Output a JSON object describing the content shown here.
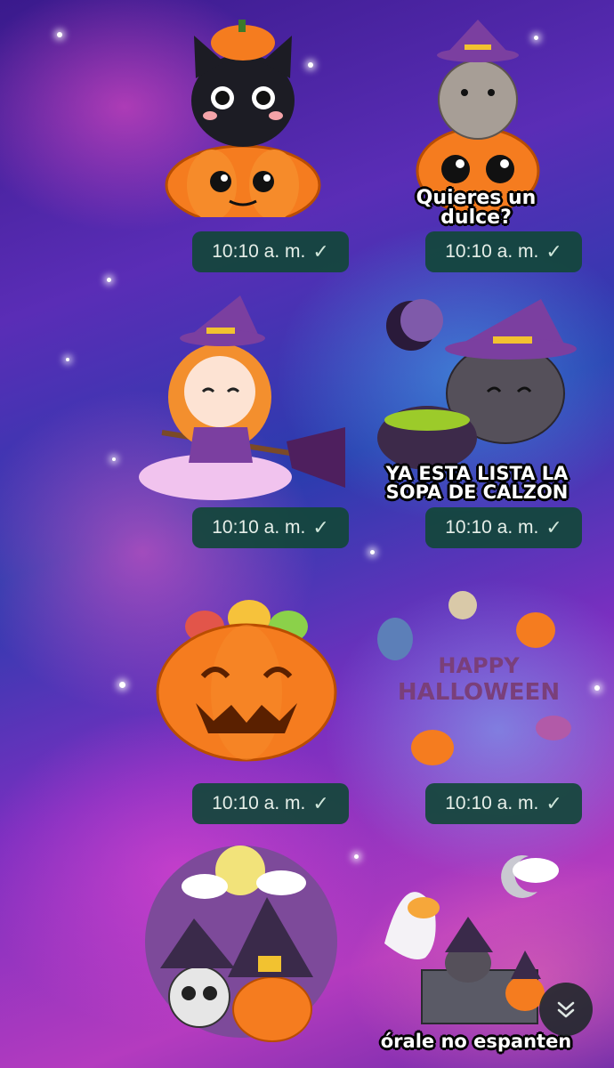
{
  "messages": [
    {
      "time": "10:10 a. m.",
      "caption": ""
    },
    {
      "time": "10:10 a. m.",
      "caption": "Quieres un dulce?"
    },
    {
      "time": "10:10 a. m.",
      "caption": ""
    },
    {
      "time": "10:10 a. m.",
      "caption": "YA ESTA LISTA LA SOPA DE CALZON"
    },
    {
      "time": "10:10 a. m.",
      "caption": ""
    },
    {
      "time": "10:10 a. m.",
      "caption": ""
    },
    {
      "time": "",
      "caption": ""
    },
    {
      "time": "",
      "caption": "órale no espanten"
    }
  ],
  "stickers": {
    "halloween_text": "HAPPY HALLOWEEN"
  },
  "icons": {
    "read_receipt": "check-icon",
    "scroll_down": "double-chevron-down-icon"
  },
  "colors": {
    "badge_bg": "#12463a",
    "pumpkin": "#f57c1f",
    "witch_purple": "#7b3fa0"
  }
}
